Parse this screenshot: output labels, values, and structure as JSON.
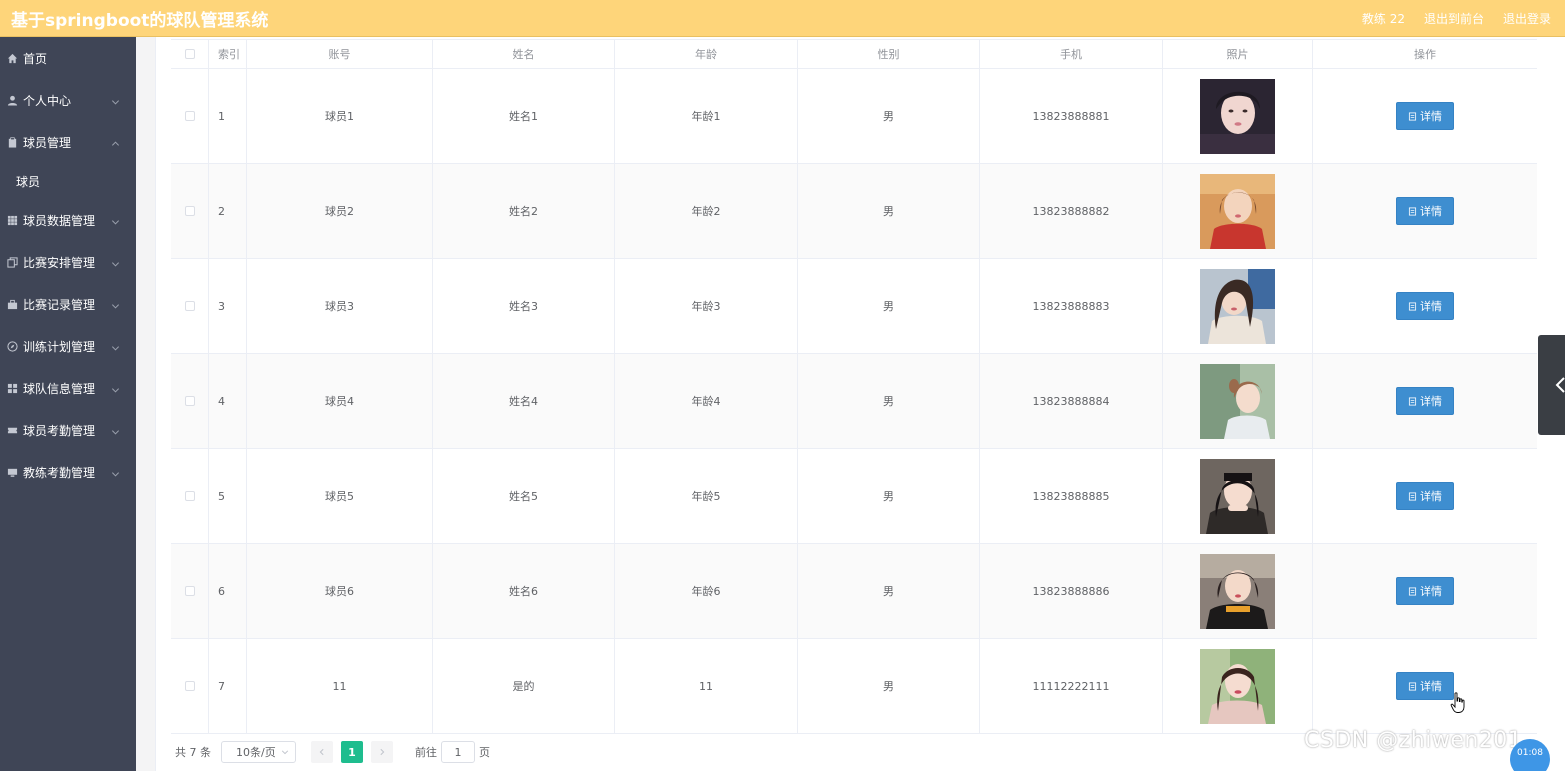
{
  "app": {
    "title": "基于springboot的球队管理系统"
  },
  "top_actions": {
    "user": "教练 22",
    "front": "退出到前台",
    "logout": "退出登录"
  },
  "sidebar": {
    "items": [
      {
        "label": "首页",
        "icon": "home-icon"
      },
      {
        "label": "个人中心",
        "icon": "user-icon"
      },
      {
        "label": "球员管理",
        "icon": "clipboard-icon",
        "expanded": true,
        "children": [
          "球员"
        ]
      },
      {
        "label": "球员数据管理",
        "icon": "grid-icon"
      },
      {
        "label": "比赛安排管理",
        "icon": "copy-icon"
      },
      {
        "label": "比赛记录管理",
        "icon": "briefcase-icon"
      },
      {
        "label": "训练计划管理",
        "icon": "compass-icon"
      },
      {
        "label": "球队信息管理",
        "icon": "apps-icon"
      },
      {
        "label": "球员考勤管理",
        "icon": "ticket-icon"
      },
      {
        "label": "教练考勤管理",
        "icon": "monitor-icon"
      }
    ]
  },
  "table": {
    "headers": [
      "索引",
      "账号",
      "姓名",
      "年龄",
      "性别",
      "手机",
      "照片",
      "操作"
    ],
    "rows": [
      {
        "index": "1",
        "account": "球员1",
        "name": "姓名1",
        "age": "年龄1",
        "sex": "男",
        "phone": "13823888881"
      },
      {
        "index": "2",
        "account": "球员2",
        "name": "姓名2",
        "age": "年龄2",
        "sex": "男",
        "phone": "13823888882"
      },
      {
        "index": "3",
        "account": "球员3",
        "name": "姓名3",
        "age": "年龄3",
        "sex": "男",
        "phone": "13823888883"
      },
      {
        "index": "4",
        "account": "球员4",
        "name": "姓名4",
        "age": "年龄4",
        "sex": "男",
        "phone": "13823888884"
      },
      {
        "index": "5",
        "account": "球员5",
        "name": "姓名5",
        "age": "年龄5",
        "sex": "男",
        "phone": "13823888885"
      },
      {
        "index": "6",
        "account": "球员6",
        "name": "姓名6",
        "age": "年龄6",
        "sex": "男",
        "phone": "13823888886"
      },
      {
        "index": "7",
        "account": "11",
        "name": "是的",
        "age": "11",
        "sex": "男",
        "phone": "11112222111"
      }
    ],
    "detail_label": "详情"
  },
  "pagination": {
    "total": "共 7 条",
    "page_size": "10条/页",
    "current_page": "1",
    "goto_label": "前往",
    "goto_value": "1",
    "page_unit": "页"
  },
  "overlay": {
    "watermark": "CSDN @zhiwen201",
    "timer": "01:08"
  },
  "colors": {
    "topbar": "#fed57a",
    "sidebar": "#3f4556",
    "primary_button": "#3e8ed0",
    "active_page": "#1ebd8e"
  }
}
